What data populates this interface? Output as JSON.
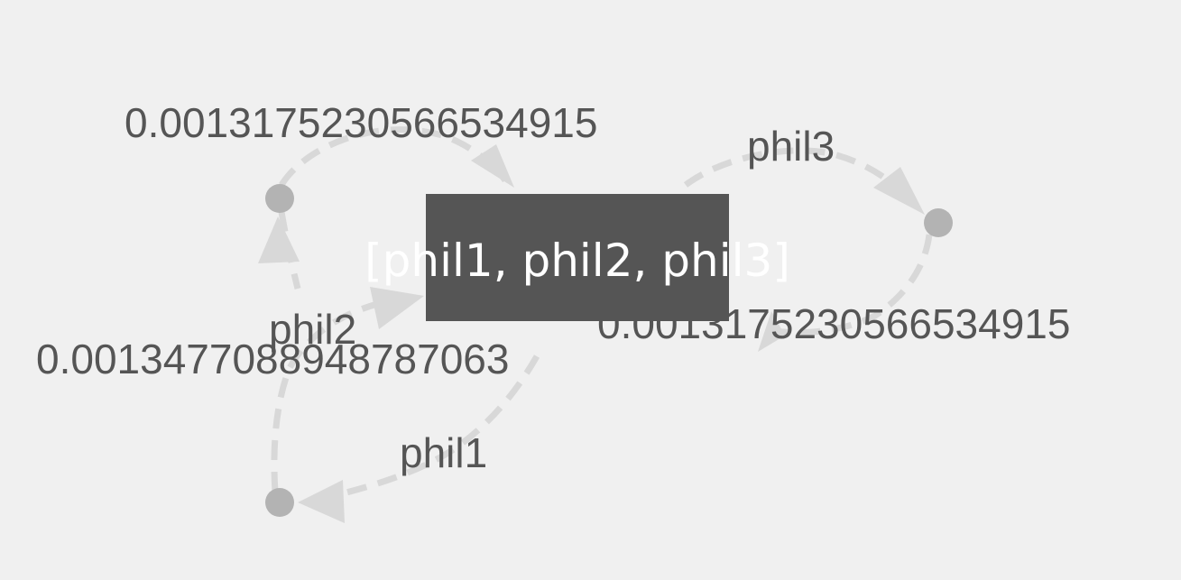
{
  "diagram": {
    "center_state_label": "[phil1, phil2, phil3]",
    "edges": [
      {
        "id": "top-left",
        "label": "0.0013175230566534915"
      },
      {
        "id": "top-right",
        "label": "phil3"
      },
      {
        "id": "right-lower",
        "label": "0.0013175230566534915"
      },
      {
        "id": "left-middle",
        "label": "phil2"
      },
      {
        "id": "left-lower",
        "label": "0.0013477088948787063"
      },
      {
        "id": "bottom",
        "label": "phil1"
      }
    ],
    "nodes": [
      {
        "id": "node-left-top"
      },
      {
        "id": "node-right"
      },
      {
        "id": "node-bottom"
      }
    ],
    "colors": {
      "background": "#f0f0f0",
      "edge": "#d8d8d8",
      "node": "#b3b3b3",
      "label": "#555555",
      "center_box": "#555555",
      "center_text": "#ffffff"
    }
  }
}
